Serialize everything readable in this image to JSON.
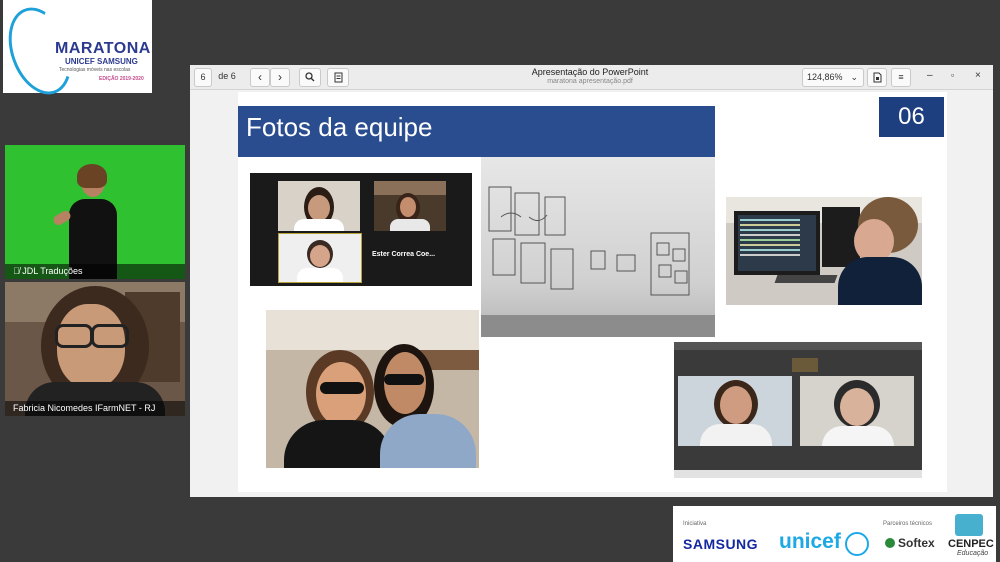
{
  "logo": {
    "title": "MARATONA",
    "subtitle": "UNICEF SAMSUNG",
    "tagline": "Tecnologias móveis nas escolas",
    "edition": "EDIÇÃO 2019-2020"
  },
  "participants": [
    {
      "name": "JDL Traduções",
      "mic_icon": "mic-muted-icon"
    },
    {
      "name": "Fabricia Nicomedes IFarmNET - RJ"
    }
  ],
  "viewer": {
    "page_current": "6",
    "page_total": "de 6",
    "title": "Apresentação do PowerPoint",
    "filename": "maratona apresentação.pdf",
    "zoom": "124,86%",
    "icons": [
      "chevron-left-icon",
      "chevron-right-icon",
      "search-icon",
      "annotation-icon",
      "save-icon",
      "menu-icon",
      "minimize-icon",
      "maximize-icon",
      "close-icon"
    ]
  },
  "slide": {
    "title": "Fotos da equipe",
    "number": "06",
    "call_caption": "Ester Correa Coe..."
  },
  "sponsors": {
    "realizacao_label": "Iniciativa",
    "parceiros_label": "Parceiros técnicos",
    "samsung": "SAMSUNG",
    "unicef": "unicef",
    "softex": "Softex",
    "cenpec": "CENPEC",
    "cenpec_sub": "Educação"
  },
  "colors": {
    "slide_title_bar": "#2a4d8f",
    "slide_num_box": "#1d3f80",
    "green_screen": "#2fc12f",
    "samsung_blue": "#1428a0",
    "unicef_blue": "#1ca9e6"
  }
}
